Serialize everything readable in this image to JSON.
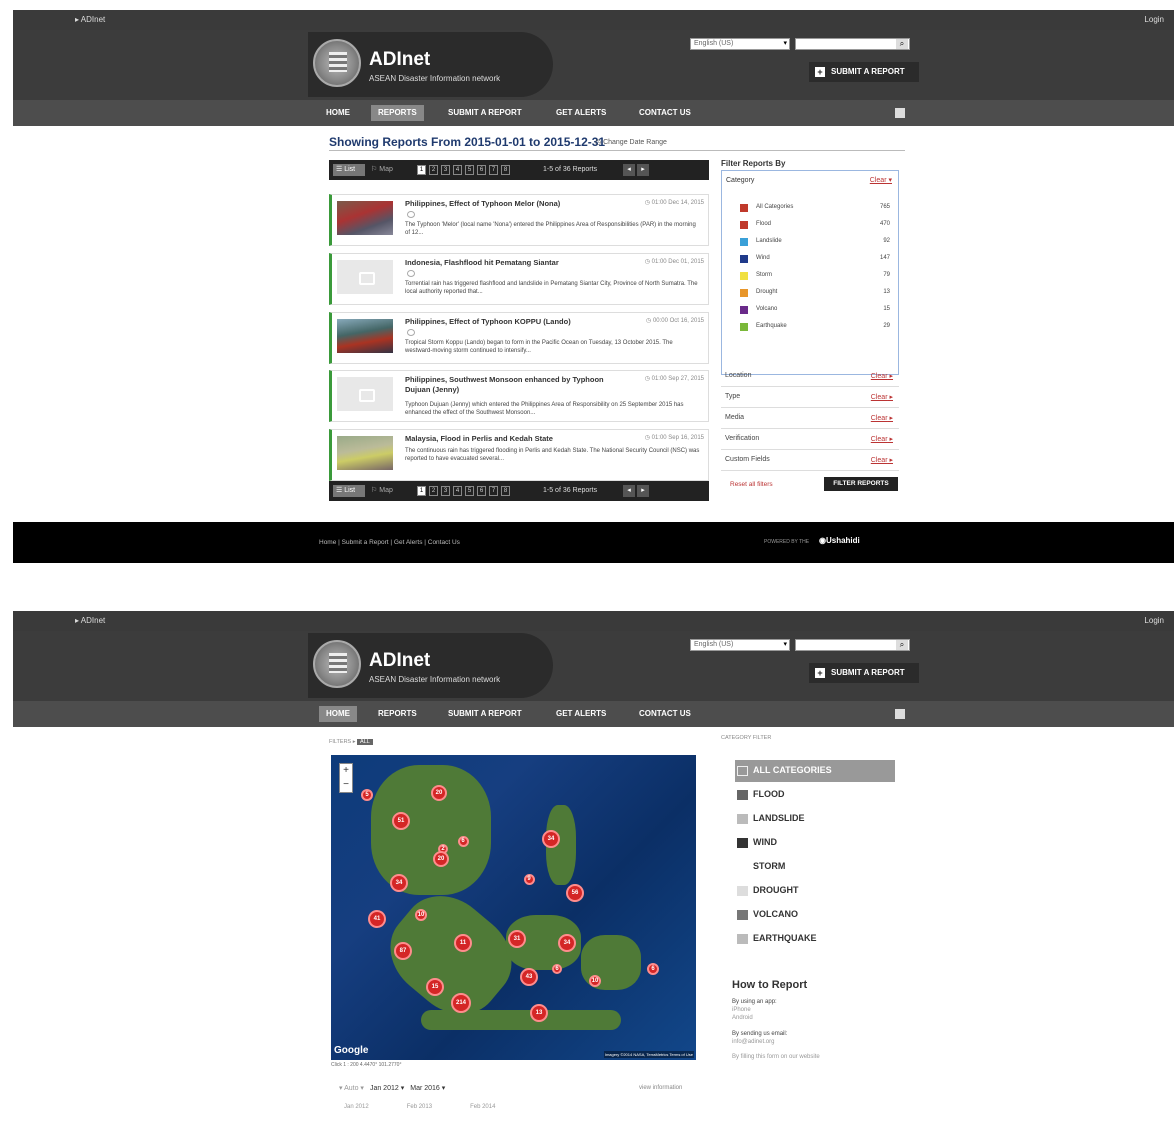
{
  "site": {
    "breadcrumb": "ADInet",
    "login": "Login",
    "brand": "ADInet",
    "tagline": "ASEAN Disaster Information network",
    "language": "English (US)",
    "submit_button": "SUBMIT A REPORT",
    "nav": [
      "HOME",
      "REPORTS",
      "SUBMIT A REPORT",
      "GET ALERTS",
      "CONTACT US"
    ]
  },
  "reports_page": {
    "heading": "Showing Reports From 2015-01-01 to 2015-12-31",
    "change_range": "Change Date Range",
    "pager": {
      "list": "List",
      "map": "Map",
      "pages": [
        "1",
        "2",
        "3",
        "4",
        "5",
        "6",
        "7",
        "8"
      ],
      "count": "1-5 of 36 Reports"
    },
    "reports": [
      {
        "title": "Philippines, Effect of Typhoon Melor (Nona)",
        "date": "01:00 Dec 14, 2015",
        "desc": "The Typhoon 'Melor' (local name 'Nona') entered the Philippines Area of Responsibilities (PAR) in the morning of 12...",
        "thumb": "photo"
      },
      {
        "title": "Indonesia, Flashflood hit Pematang Siantar",
        "date": "01:00 Dec 01, 2015",
        "desc": "Torrential rain has triggered flashflood and landslide in Pematang Siantar City, Province of North Sumatra. The local authority reported that...",
        "thumb": "blank"
      },
      {
        "title": "Philippines, Effect of Typhoon KOPPU (Lando)",
        "date": "00:00 Oct 16, 2015",
        "desc": "Tropical Storm Koppu (Lando) began to form in the Pacific Ocean on Tuesday, 13 October 2015. The westward-moving storm continued to intensify...",
        "thumb": "photo2"
      },
      {
        "title": "Philippines, Southwest Monsoon enhanced by Typhoon Dujuan (Jenny)",
        "date": "01:00 Sep 27, 2015",
        "desc": "Typhoon Dujuan (Jenny) which entered the Philippines Area of Responsibility on 25 September 2015 has enhanced the effect of the Southwest Monsoon...",
        "thumb": "blank"
      },
      {
        "title": "Malaysia, Flood in Perlis and Kedah State",
        "date": "01:00 Sep 16, 2015",
        "desc": "The continuous rain has triggered flooding in Perlis and Kedah State. The National Security Council (NSC) was reported to have evacuated several...",
        "thumb": "photo3"
      }
    ],
    "filter": {
      "title": "Filter Reports By",
      "category_label": "Category",
      "clear": "Clear",
      "categories": [
        {
          "name": "All Categories",
          "count": "765",
          "color": "#c0392b"
        },
        {
          "name": "Flood",
          "count": "470",
          "color": "#c0392b"
        },
        {
          "name": "Landslide",
          "count": "92",
          "color": "#3aa0d8"
        },
        {
          "name": "Wind",
          "count": "147",
          "color": "#1f3a8a"
        },
        {
          "name": "Storm",
          "count": "79",
          "color": "#f0e040"
        },
        {
          "name": "Drought",
          "count": "13",
          "color": "#e8962a"
        },
        {
          "name": "Volcano",
          "count": "15",
          "color": "#6a2a8a"
        },
        {
          "name": "Earthquake",
          "count": "29",
          "color": "#7ab83a"
        }
      ],
      "facets": [
        "Location",
        "Type",
        "Media",
        "Verification",
        "Custom Fields"
      ],
      "reset": "Reset all filters",
      "filter_button": "FILTER REPORTS"
    },
    "footer": {
      "links": "Home | Submit a Report | Get Alerts | Contact Us",
      "powered": "POWERED BY THE",
      "platform": "Ushahidi"
    }
  },
  "home_page": {
    "filters_label": "FILTERS",
    "filters_all": "ALL",
    "category_filter_label": "CATEGORY FILTER",
    "map_clusters": [
      {
        "label": "5"
      },
      {
        "label": "20"
      },
      {
        "label": "51"
      },
      {
        "label": "2"
      },
      {
        "label": "6"
      },
      {
        "label": "20"
      },
      {
        "label": "34"
      },
      {
        "label": "34"
      },
      {
        "label": "9"
      },
      {
        "label": "56"
      },
      {
        "label": "41"
      },
      {
        "label": "10"
      },
      {
        "label": "11"
      },
      {
        "label": "31"
      },
      {
        "label": "34"
      },
      {
        "label": "87"
      },
      {
        "label": "6"
      },
      {
        "label": "43"
      },
      {
        "label": "15"
      },
      {
        "label": "214"
      },
      {
        "label": "10"
      },
      {
        "label": "6"
      },
      {
        "label": "13"
      }
    ],
    "google": "Google",
    "attribution": "Imagery ©2014 NASA, TerraMetrics  Terms of Use",
    "scale": "Click   1 : 200      4.4470° 101.2770°",
    "timeline": {
      "view": "Auto",
      "from": "Jan 2012",
      "to": "Mar 2016",
      "more_info": "view information",
      "ticks": [
        "Jan 2012",
        "Feb 2013",
        "Feb 2014"
      ]
    },
    "categories": [
      "ALL CATEGORIES",
      "FLOOD",
      "LANDSLIDE",
      "WIND",
      "STORM",
      "DROUGHT",
      "VOLCANO",
      "EARTHQUAKE"
    ],
    "category_colors": [
      "#bbbbbb",
      "#666666",
      "#bbbbbb",
      "#333333",
      "#ffffff",
      "#dddddd",
      "#777777",
      "#bbbbbb"
    ],
    "how_to_report": {
      "title": "How to Report",
      "by_app": "By using an app:",
      "apps": "iPhone",
      "apps2": "Android",
      "by_email": "By sending us email:",
      "email": "info@adinet.org",
      "by_form": "By filling this form on our website"
    }
  }
}
